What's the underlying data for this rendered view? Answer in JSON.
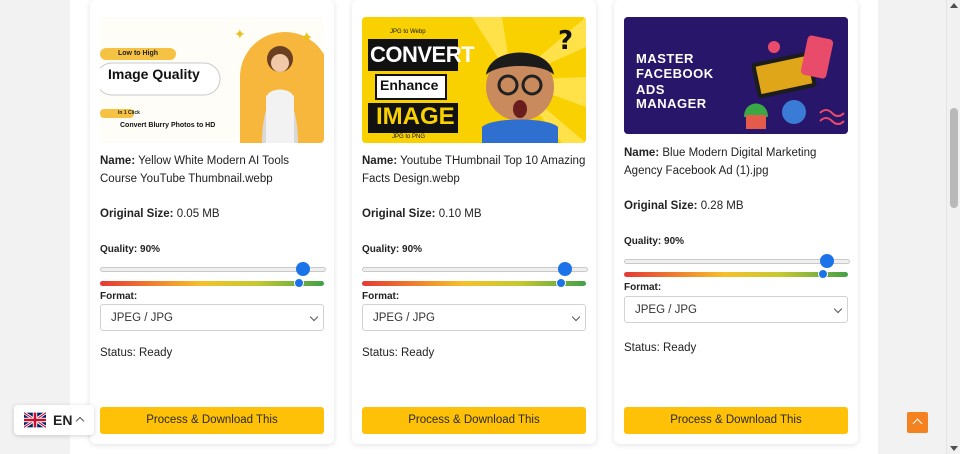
{
  "cards": [
    {
      "thumbnail": {
        "badge_top": "Low to High",
        "headline": "Image Quality",
        "badge_small": "In 1 Click",
        "tagline": "Convert Blurry Photos to HD"
      },
      "name_label": "Name:",
      "name_value": "Yellow White Modern AI Tools Course YouTube Thumbnail.webp",
      "size_label": "Original Size:",
      "size_value": "0.05 MB",
      "quality_text": "Quality: 90%",
      "quality": 0.9,
      "format_label": "Format:",
      "format_value": "JPEG / JPG",
      "status_text": "Status: Ready",
      "button_label": "Process & Download This"
    },
    {
      "thumbnail": {
        "top_text": "JPG to Webp",
        "line1": "CONVERT",
        "line2": "Enhance",
        "line3": "IMAGE",
        "bottom_text": "JPG to PNG"
      },
      "name_label": "Name:",
      "name_value": "Youtube THumbnail Top 10 Amazing Facts Design.webp",
      "size_label": "Original Size:",
      "size_value": "0.10 MB",
      "quality_text": "Quality: 90%",
      "quality": 0.9,
      "format_label": "Format:",
      "format_value": "JPEG / JPG",
      "status_text": "Status: Ready",
      "button_label": "Process & Download This"
    },
    {
      "thumbnail": {
        "line1": "MASTER",
        "line2": "FACEBOOK",
        "line3": "ADS",
        "line4": "MANAGER"
      },
      "name_label": "Name:",
      "name_value": "Blue Modern Digital Marketing Agency Facebook Ad (1).jpg",
      "size_label": "Original Size:",
      "size_value": "0.28 MB",
      "quality_text": "Quality: 90%",
      "quality": 0.9,
      "format_label": "Format:",
      "format_value": "JPEG / JPG",
      "status_text": "Status: Ready",
      "button_label": "Process & Download This"
    }
  ],
  "language": {
    "code": "EN",
    "flag_icon": "uk-flag-icon",
    "caret_icon": "chevron-up-icon"
  },
  "back_to_top": {
    "icon": "chevron-up-icon",
    "color": "#f58220"
  },
  "colors": {
    "accent_button": "#ffc107",
    "slider": "#1a73e8"
  }
}
